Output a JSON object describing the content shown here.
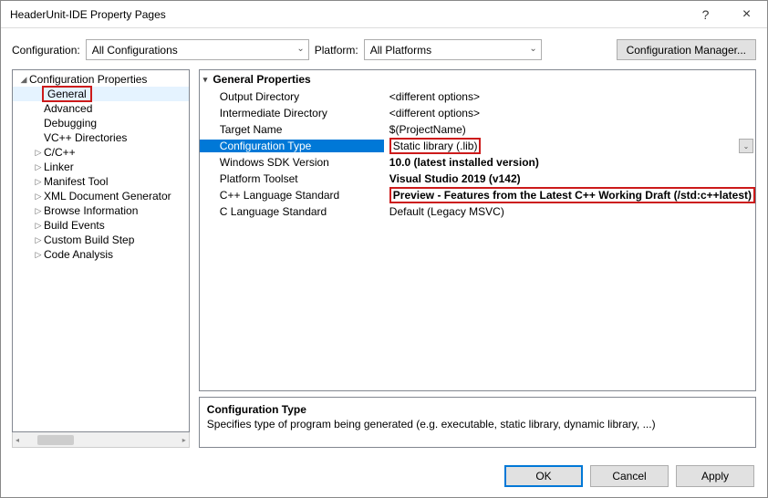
{
  "window": {
    "title": "HeaderUnit-IDE Property Pages"
  },
  "config": {
    "label": "Configuration:",
    "value": "All Configurations",
    "platform_label": "Platform:",
    "platform_value": "All Platforms",
    "manager": "Configuration Manager..."
  },
  "tree": {
    "root": "Configuration Properties",
    "items": [
      "General",
      "Advanced",
      "Debugging",
      "VC++ Directories",
      "C/C++",
      "Linker",
      "Manifest Tool",
      "XML Document Generator",
      "Browse Information",
      "Build Events",
      "Custom Build Step",
      "Code Analysis"
    ],
    "collapsibleFrom": 4
  },
  "grid": {
    "header": "General Properties",
    "rows": [
      {
        "label": "Output Directory",
        "value": "<different options>"
      },
      {
        "label": "Intermediate Directory",
        "value": "<different options>"
      },
      {
        "label": "Target Name",
        "value": "$(ProjectName)"
      },
      {
        "label": "Configuration Type",
        "value": "Static library (.lib)",
        "selected": true,
        "redValue": true,
        "dropdown": true
      },
      {
        "label": "Windows SDK Version",
        "value": "10.0 (latest installed version)",
        "bold": true
      },
      {
        "label": "Platform Toolset",
        "value": "Visual Studio 2019 (v142)",
        "bold": true
      },
      {
        "label": "C++ Language Standard",
        "value": "Preview - Features from the Latest C++ Working Draft (/std:c++latest)",
        "bold": true,
        "redValue": true
      },
      {
        "label": "C Language Standard",
        "value": "Default (Legacy MSVC)"
      }
    ]
  },
  "desc": {
    "title": "Configuration Type",
    "text": "Specifies type of program being generated (e.g. executable, static library, dynamic library, ...)"
  },
  "buttons": {
    "ok": "OK",
    "cancel": "Cancel",
    "apply": "Apply"
  }
}
